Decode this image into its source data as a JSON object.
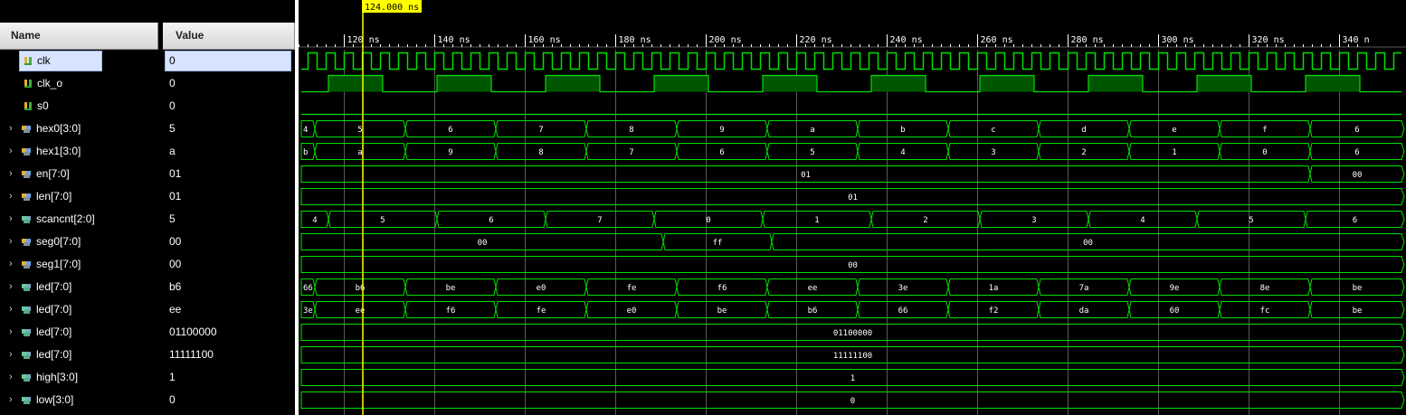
{
  "cursor": {
    "label": "124.000 ns",
    "time": 124.0
  },
  "columns": {
    "name": "Name",
    "value": "Value"
  },
  "timeline": {
    "ticks": [
      {
        "t": 120,
        "label": "120 ns"
      },
      {
        "t": 140,
        "label": "140 ns"
      },
      {
        "t": 160,
        "label": "160 ns"
      },
      {
        "t": 180,
        "label": "180 ns"
      },
      {
        "t": 200,
        "label": "200 ns"
      },
      {
        "t": 220,
        "label": "220 ns"
      },
      {
        "t": 240,
        "label": "240 ns"
      },
      {
        "t": 260,
        "label": "260 ns"
      },
      {
        "t": 280,
        "label": "280 ns"
      },
      {
        "t": 300,
        "label": "300 ns"
      },
      {
        "t": 320,
        "label": "320 ns"
      },
      {
        "t": 340,
        "label": "340 n"
      }
    ]
  },
  "signals": [
    {
      "name": "clk",
      "value": "0",
      "icon": "bit-signal-icon",
      "expandable": false,
      "selected": true,
      "type": "clk"
    },
    {
      "name": "clk_o",
      "value": "0",
      "icon": "bit-signal-icon",
      "expandable": false,
      "type": "bit",
      "segments": [
        {
          "t": 110.5,
          "v": 0
        },
        {
          "t": 116.5,
          "v": 1
        },
        {
          "t": 128.5,
          "v": 0
        },
        {
          "t": 140.5,
          "v": 1
        },
        {
          "t": 152.5,
          "v": 0
        },
        {
          "t": 164.5,
          "v": 1
        },
        {
          "t": 176.5,
          "v": 0
        },
        {
          "t": 188.5,
          "v": 1
        },
        {
          "t": 200.5,
          "v": 0
        },
        {
          "t": 212.5,
          "v": 1
        },
        {
          "t": 224.5,
          "v": 0
        },
        {
          "t": 236.5,
          "v": 1
        },
        {
          "t": 248.5,
          "v": 0
        },
        {
          "t": 260.5,
          "v": 1
        },
        {
          "t": 272.5,
          "v": 0
        },
        {
          "t": 284.5,
          "v": 1
        },
        {
          "t": 296.5,
          "v": 0
        },
        {
          "t": 308.5,
          "v": 1
        },
        {
          "t": 320.5,
          "v": 0
        },
        {
          "t": 332.5,
          "v": 1
        },
        {
          "t": 344.5,
          "v": 0
        }
      ]
    },
    {
      "name": "s0",
      "value": "0",
      "icon": "bit-signal-icon",
      "expandable": false,
      "type": "bit",
      "segments": [
        {
          "t": 110.5,
          "v": 0
        }
      ]
    },
    {
      "name": "hex0[3:0]",
      "value": "5",
      "icon": "bus-signal-icon",
      "expandable": true,
      "type": "bus",
      "segments": [
        {
          "t": 110.5,
          "v": "4"
        },
        {
          "t": 113.5,
          "v": "5"
        },
        {
          "t": 133.5,
          "v": "6"
        },
        {
          "t": 153.5,
          "v": "7"
        },
        {
          "t": 173.5,
          "v": "8"
        },
        {
          "t": 193.5,
          "v": "9"
        },
        {
          "t": 213.5,
          "v": "a"
        },
        {
          "t": 233.5,
          "v": "b"
        },
        {
          "t": 253.5,
          "v": "c"
        },
        {
          "t": 273.5,
          "v": "d"
        },
        {
          "t": 293.5,
          "v": "e"
        },
        {
          "t": 313.5,
          "v": "f"
        },
        {
          "t": 333.5,
          "v": "6"
        }
      ]
    },
    {
      "name": "hex1[3:0]",
      "value": "a",
      "icon": "bus-signal-icon",
      "expandable": true,
      "type": "bus",
      "segments": [
        {
          "t": 110.5,
          "v": "b"
        },
        {
          "t": 113.5,
          "v": "a"
        },
        {
          "t": 133.5,
          "v": "9"
        },
        {
          "t": 153.5,
          "v": "8"
        },
        {
          "t": 173.5,
          "v": "7"
        },
        {
          "t": 193.5,
          "v": "6"
        },
        {
          "t": 213.5,
          "v": "5"
        },
        {
          "t": 233.5,
          "v": "4"
        },
        {
          "t": 253.5,
          "v": "3"
        },
        {
          "t": 273.5,
          "v": "2"
        },
        {
          "t": 293.5,
          "v": "1"
        },
        {
          "t": 313.5,
          "v": "0"
        },
        {
          "t": 333.5,
          "v": "6"
        }
      ]
    },
    {
      "name": "en[7:0]",
      "value": "01",
      "icon": "bus-signal-icon",
      "expandable": true,
      "type": "bus",
      "segments": [
        {
          "t": 110.5,
          "v": "01"
        },
        {
          "t": 333.5,
          "v": "00"
        }
      ]
    },
    {
      "name": "len[7:0]",
      "value": "01",
      "icon": "bus-signal-icon",
      "expandable": true,
      "type": "bus",
      "segments": [
        {
          "t": 110.5,
          "v": "01"
        }
      ]
    },
    {
      "name": "scancnt[2:0]",
      "value": "5",
      "icon": "bus-reg-icon",
      "expandable": true,
      "type": "bus",
      "segments": [
        {
          "t": 110.5,
          "v": "4"
        },
        {
          "t": 116.5,
          "v": "5"
        },
        {
          "t": 140.5,
          "v": "6"
        },
        {
          "t": 164.5,
          "v": "7"
        },
        {
          "t": 188.5,
          "v": "0"
        },
        {
          "t": 212.5,
          "v": "1"
        },
        {
          "t": 236.5,
          "v": "2"
        },
        {
          "t": 260.5,
          "v": "3"
        },
        {
          "t": 284.5,
          "v": "4"
        },
        {
          "t": 308.5,
          "v": "5"
        },
        {
          "t": 332.5,
          "v": "6"
        }
      ]
    },
    {
      "name": "seg0[7:0]",
      "value": "00",
      "icon": "bus-signal-icon",
      "expandable": true,
      "type": "bus",
      "segments": [
        {
          "t": 110.5,
          "v": "00"
        },
        {
          "t": 190.5,
          "v": "ff"
        },
        {
          "t": 214.5,
          "v": "00"
        }
      ]
    },
    {
      "name": "seg1[7:0]",
      "value": "00",
      "icon": "bus-signal-icon",
      "expandable": true,
      "type": "bus",
      "segments": [
        {
          "t": 110.5,
          "v": "00"
        }
      ]
    },
    {
      "name": "led[7:0]",
      "value": "b6",
      "icon": "bus-reg-icon",
      "expandable": true,
      "type": "bus",
      "segments": [
        {
          "t": 110.5,
          "v": "66"
        },
        {
          "t": 113.5,
          "v": "b6"
        },
        {
          "t": 133.5,
          "v": "be"
        },
        {
          "t": 153.5,
          "v": "e0"
        },
        {
          "t": 173.5,
          "v": "fe"
        },
        {
          "t": 193.5,
          "v": "f6"
        },
        {
          "t": 213.5,
          "v": "ee"
        },
        {
          "t": 233.5,
          "v": "3e"
        },
        {
          "t": 253.5,
          "v": "1a"
        },
        {
          "t": 273.5,
          "v": "7a"
        },
        {
          "t": 293.5,
          "v": "9e"
        },
        {
          "t": 313.5,
          "v": "8e"
        },
        {
          "t": 333.5,
          "v": "be"
        }
      ]
    },
    {
      "name": "led[7:0]",
      "value": "ee",
      "icon": "bus-reg-icon",
      "expandable": true,
      "type": "bus",
      "segments": [
        {
          "t": 110.5,
          "v": "3e"
        },
        {
          "t": 113.5,
          "v": "ee"
        },
        {
          "t": 133.5,
          "v": "f6"
        },
        {
          "t": 153.5,
          "v": "fe"
        },
        {
          "t": 173.5,
          "v": "e0"
        },
        {
          "t": 193.5,
          "v": "be"
        },
        {
          "t": 213.5,
          "v": "b6"
        },
        {
          "t": 233.5,
          "v": "66"
        },
        {
          "t": 253.5,
          "v": "f2"
        },
        {
          "t": 273.5,
          "v": "da"
        },
        {
          "t": 293.5,
          "v": "60"
        },
        {
          "t": 313.5,
          "v": "fc"
        },
        {
          "t": 333.5,
          "v": "be"
        }
      ]
    },
    {
      "name": "led[7:0]",
      "value": "01100000",
      "icon": "bus-reg-icon",
      "expandable": true,
      "type": "bus",
      "segments": [
        {
          "t": 110.5,
          "v": "01100000"
        }
      ]
    },
    {
      "name": "led[7:0]",
      "value": "11111100",
      "icon": "bus-reg-icon",
      "expandable": true,
      "type": "bus",
      "segments": [
        {
          "t": 110.5,
          "v": "11111100"
        }
      ]
    },
    {
      "name": "high[3:0]",
      "value": "1",
      "icon": "bus-reg-icon",
      "expandable": true,
      "type": "bus",
      "segments": [
        {
          "t": 110.5,
          "v": "1"
        }
      ]
    },
    {
      "name": "low[3:0]",
      "value": "0",
      "icon": "bus-reg-icon",
      "expandable": true,
      "type": "bus",
      "segments": [
        {
          "t": 110.5,
          "v": "0"
        }
      ]
    }
  ],
  "colors": {
    "wave": "#00e000",
    "wave_fill": "#005500",
    "cursor": "#ffff00",
    "grid": "#5a5a5a",
    "selection": "#d7e4ff"
  }
}
